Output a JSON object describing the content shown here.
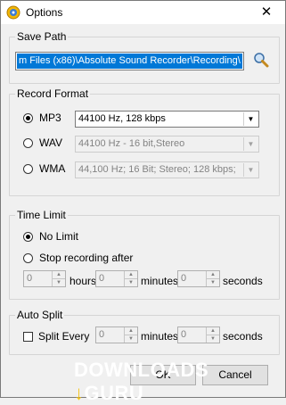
{
  "window": {
    "title": "Options",
    "close_glyph": "✕"
  },
  "save_path": {
    "title": "Save Path",
    "value": "m Files (x86)\\Absolute Sound Recorder\\Recording\\",
    "browse_icon": "magnifier-icon"
  },
  "record_format": {
    "title": "Record Format",
    "options": [
      {
        "label": "MP3",
        "selected": true,
        "combo": "44100 Hz, 128 kbps",
        "enabled": true
      },
      {
        "label": "WAV",
        "selected": false,
        "combo": "44100 Hz - 16 bit,Stereo",
        "enabled": false
      },
      {
        "label": "WMA",
        "selected": false,
        "combo": "44,100 Hz; 16 Bit; Stereo; 128 kbps;",
        "enabled": false
      }
    ]
  },
  "time_limit": {
    "title": "Time Limit",
    "no_limit_label": "No Limit",
    "stop_after_label": "Stop recording after",
    "hours_value": "0",
    "hours_label": "hours",
    "minutes_value": "0",
    "minutes_label": "minutes",
    "seconds_value": "0",
    "seconds_label": "seconds"
  },
  "auto_split": {
    "title": "Auto Split",
    "split_every_label": "Split Every",
    "checked": false,
    "minutes_value": "0",
    "minutes_label": "minutes",
    "seconds_value": "0",
    "seconds_label": "seconds"
  },
  "buttons": {
    "ok": "OK",
    "cancel": "Cancel"
  },
  "watermark": {
    "text_left": "DOWNLOADS",
    "text_right": "GURU"
  }
}
